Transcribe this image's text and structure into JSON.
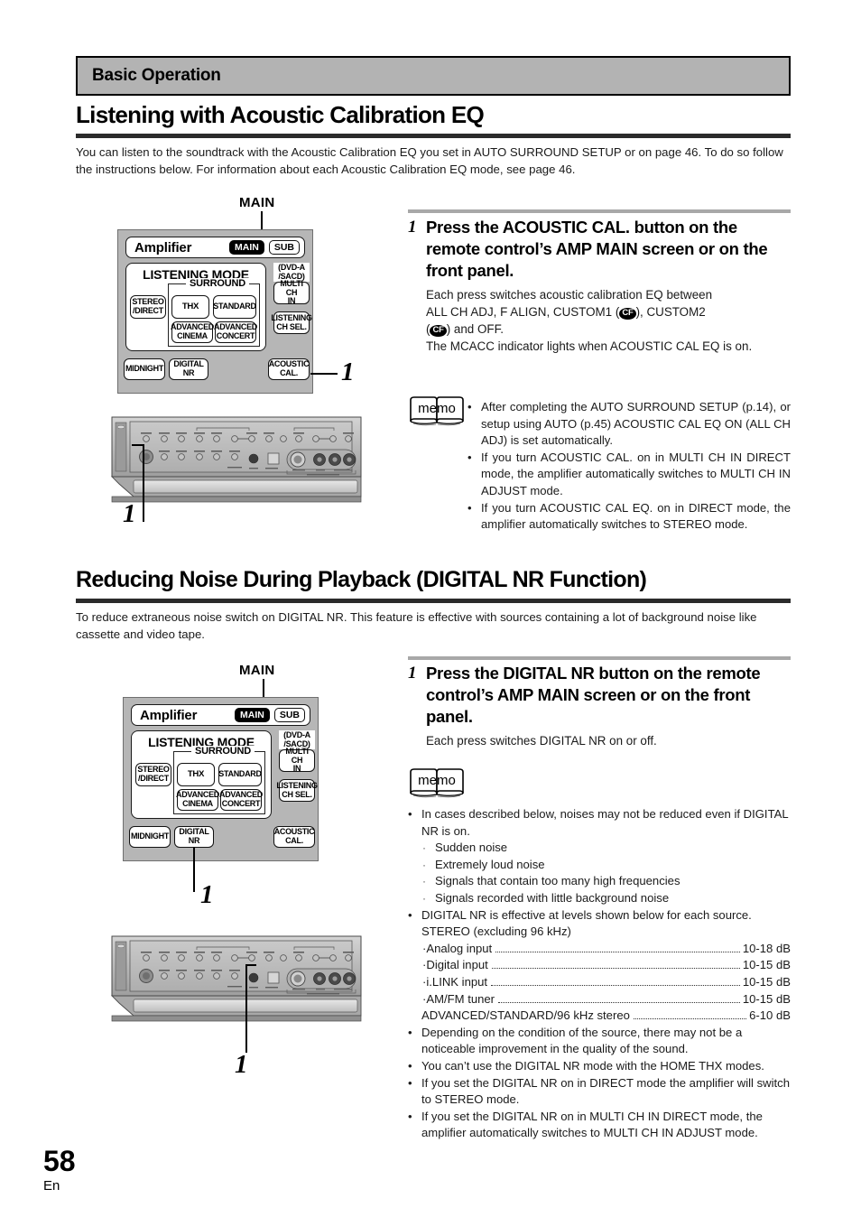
{
  "header": {
    "section_label": "Basic Operation"
  },
  "page": {
    "number": "58",
    "lang": "En"
  },
  "section1": {
    "title": "Listening with Acoustic Calibration EQ",
    "intro": "You can listen to the soundtrack with the Acoustic Calibration EQ you set in AUTO SURROUND SETUP or on page 46. To do so follow the instructions below. For information about each Acoustic Calibration EQ mode, see page 46.",
    "diagram_label": "MAIN",
    "callout_number": "1",
    "panel_callout_number": "1",
    "step": {
      "number": "1",
      "title": "Press the ACOUSTIC CAL. button on the remote control’s AMP MAIN screen or on the front panel.",
      "body_line1": "Each press switches acoustic calibration EQ between",
      "body_line2_a": "ALL CH ADJ, F ALIGN, CUSTOM1 (",
      "body_cf": "CF",
      "body_line2_b": "), CUSTOM2",
      "body_line3_a": "(",
      "body_line3_b": ") and OFF.",
      "body_line4": "The MCACC indicator lights when ACOUSTIC CAL EQ is on."
    },
    "memo": {
      "label": "memo",
      "bullets": [
        "After completing the AUTO SURROUND SETUP (p.14),  or setup using AUTO (p.45) ACOUSTIC CAL EQ ON (ALL CH ADJ) is set automatically.",
        "If you turn ACOUSTIC CAL. on in MULTI CH IN DIRECT mode, the amplifier automatically switches to MULTI CH IN ADJUST mode.",
        "If you turn ACOUSTIC CAL EQ. on in DIRECT mode, the amplifier automatically switches to STEREO mode."
      ]
    }
  },
  "section2": {
    "title": "Reducing Noise During Playback (DIGITAL NR Function)",
    "intro": "To reduce extraneous noise switch on DIGITAL NR. This feature is effective with sources containing a lot of background noise like cassette and video tape.",
    "diagram_label": "MAIN",
    "callout_number": "1",
    "panel_callout_number": "1",
    "step": {
      "number": "1",
      "title": "Press the DIGITAL NR button on the remote control’s AMP MAIN screen or on the front panel.",
      "body_line1": "Each press switches DIGITAL NR on or off."
    },
    "memo": {
      "label": "memo",
      "bullet1": "In cases described below, noises may not be reduced even if DIGITAL NR is on.",
      "bullet1_sub": [
        "Sudden noise",
        "Extremely loud noise",
        "Signals that contain too many high frequencies",
        "Signals recorded with little background noise"
      ],
      "bullet2": "DIGITAL NR is effective at levels shown below for each source.",
      "levels_heading": "STEREO (excluding 96 kHz)",
      "levels": [
        {
          "name": "Analog input",
          "value": "10-18 dB"
        },
        {
          "name": "Digital input",
          "value": "10-15 dB"
        },
        {
          "name": "i.LINK input",
          "value": "10-15 dB"
        },
        {
          "name": "AM/FM tuner",
          "value": "10-15 dB"
        }
      ],
      "levels_last": {
        "name": "ADVANCED/STANDARD/96 kHz stereo",
        "value": "6-10 dB"
      },
      "bullets_tail": [
        "Depending on the condition of the source, there may not be a noticeable improvement in the quality of the sound.",
        "You can’t use the DIGITAL NR mode with the HOME THX modes.",
        "If you set the DIGITAL NR on in DIRECT mode the amplifier will switch to STEREO mode.",
        "If you set the DIGITAL NR on in MULTI CH IN DIRECT mode, the amplifier automatically switches to MULTI CH IN ADJUST mode."
      ]
    }
  },
  "remote": {
    "amplifier_label": "Amplifier",
    "pill_main": "MAIN",
    "pill_sub": "SUB",
    "listening_mode_title": "LISTENING MODE",
    "surround_label": "SURROUND",
    "buttons": {
      "stereo_direct": "STEREO\n/DIRECT",
      "thx": "THX",
      "standard": "STANDARD",
      "advanced_cinema": "ADVANCED\nCINEMA",
      "advanced_concert": "ADVANCED\nCONCERT",
      "dvda_sacd": "(DVD-A\n/SACD)",
      "multi_ch_in": "MULTI CH\nIN",
      "listening_ch_sel": "LISTENING\nCH SEL.",
      "midnight": "MIDNIGHT",
      "digital_nr": "DIGITAL\nNR",
      "acoustic_cal": "ACOUSTIC\nCAL."
    }
  },
  "colors": {
    "band_gray": "#b3b3b3",
    "rule_dark": "#2b2b2b",
    "rule_light": "#a8a8a8",
    "lcd_gray": "#b6b6b6"
  }
}
